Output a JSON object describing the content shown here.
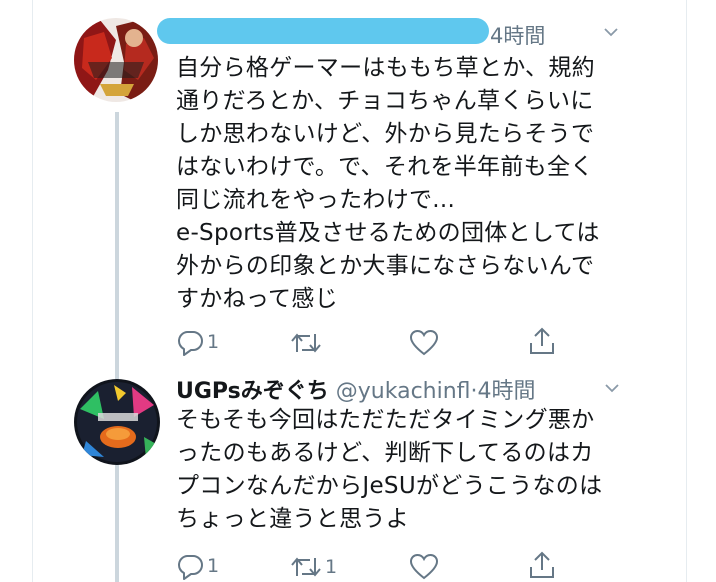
{
  "colors": {
    "thread_line": "#ccd6dd",
    "meta_text": "#657786",
    "redaction": "#5fc8ee"
  },
  "tweet1": {
    "time": "4時間",
    "lines": [
      "自分ら格ゲーマーはももち草とか、規約",
      "通りだろとか、チョコちゃん草くらいに",
      "しか思わないけど、外から見たらそうで",
      "はないわけで。で、それを半年前も全く",
      "同じ流れをやったわけで...",
      "e-Sports普及させるための団体としては",
      "外からの印象とか大事になさらないんで",
      "すかねって感じ"
    ],
    "actions": {
      "reply_count": "1",
      "retweet_count": "",
      "like_count": ""
    }
  },
  "tweet2": {
    "name": "UGPsみぞぐち",
    "handle": "@yukachinfl",
    "dot": "·",
    "time": "4時間",
    "lines": [
      "そもそも今回はただただタイミング悪か",
      "ったのもあるけど、判断下してるのはカ",
      "プコンなんだからJeSUがどうこうなのは",
      "ちょっと違うと思うよ"
    ],
    "actions": {
      "reply_count": "1",
      "retweet_count": "1",
      "like_count": ""
    }
  },
  "icons": [
    "reply-icon",
    "retweet-icon",
    "like-icon",
    "share-icon",
    "chevron-down-icon"
  ]
}
